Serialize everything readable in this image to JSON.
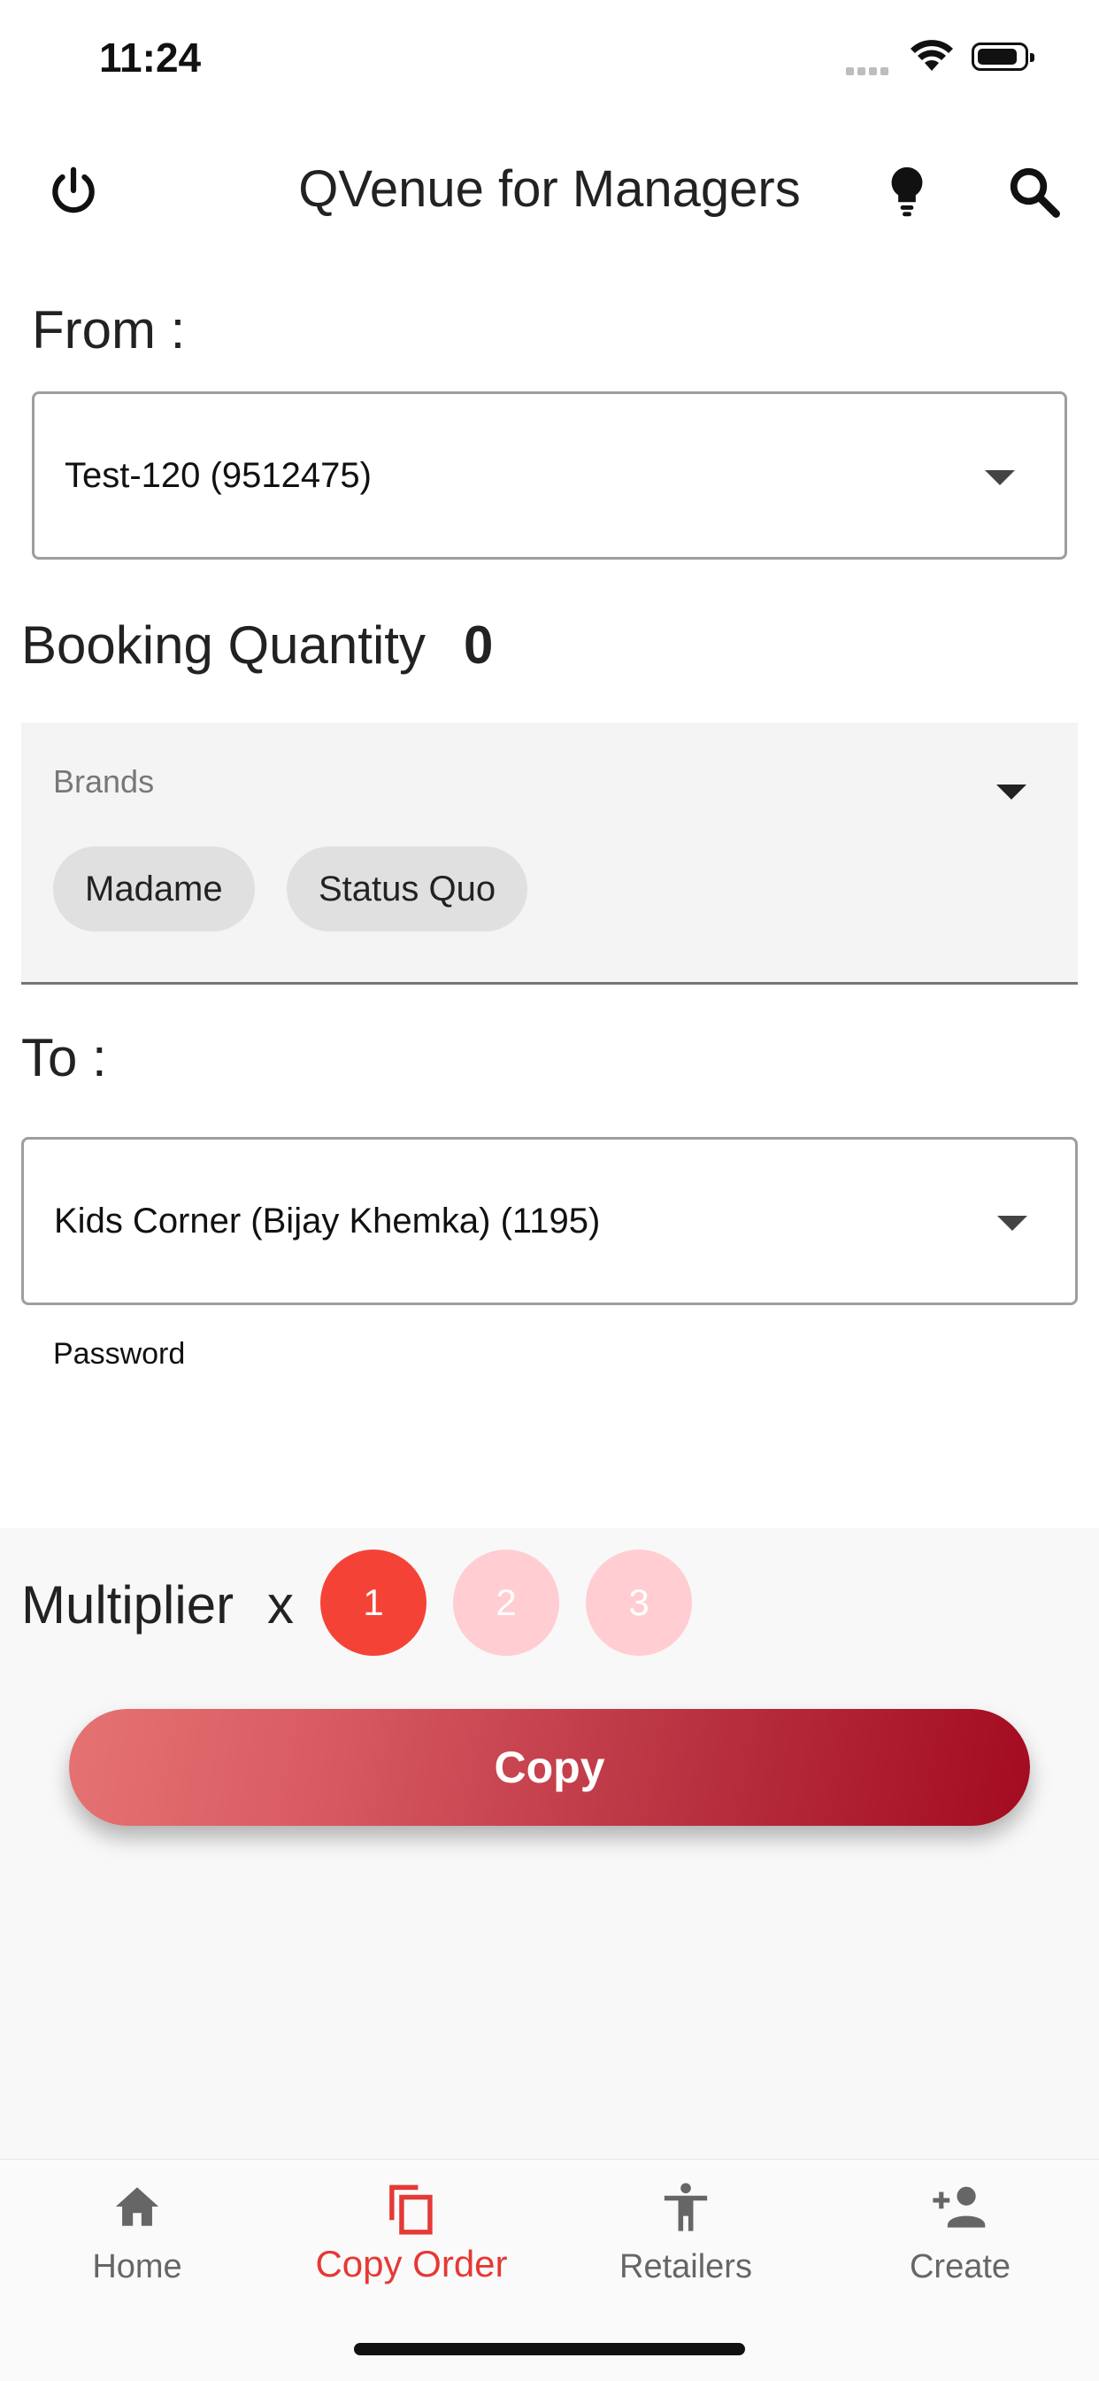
{
  "status_bar": {
    "time": "11:24"
  },
  "app_bar": {
    "title": "QVenue for Managers"
  },
  "from": {
    "label": "From :",
    "selected": "Test-120 (9512475)"
  },
  "booking_quantity": {
    "label": "Booking Quantity",
    "value": "0"
  },
  "brands": {
    "label": "Brands",
    "chips": [
      "Madame",
      "Status Quo"
    ]
  },
  "to": {
    "label": "To :",
    "selected": "Kids Corner (Bijay Khemka) (1195)"
  },
  "password": {
    "label": "Password"
  },
  "multiplier": {
    "label": "Multiplier",
    "x": "x",
    "options": [
      "1",
      "2",
      "3"
    ],
    "selected": "1"
  },
  "copy_button": {
    "label": "Copy"
  },
  "bottom_nav": {
    "items": [
      {
        "label": "Home",
        "icon": "home-icon"
      },
      {
        "label": "Copy Order",
        "icon": "copy-icon",
        "active": true
      },
      {
        "label": "Retailers",
        "icon": "person-icon"
      },
      {
        "label": "Create",
        "icon": "person-add-icon"
      }
    ]
  },
  "colors": {
    "accent": "#f44336",
    "accent_light": "#ffcdd2",
    "gradient_start": "#e57373",
    "gradient_end": "#a30b20"
  }
}
